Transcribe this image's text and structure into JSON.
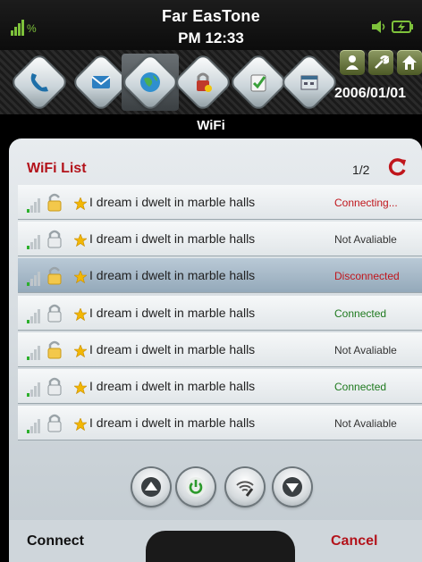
{
  "statusbar": {
    "carrier": "Far EasTone",
    "time": "PM 12:33",
    "icons": [
      "signal-icon",
      "speaker-icon",
      "battery-icon"
    ]
  },
  "toolbar": {
    "apps": [
      "phone-app-icon",
      "messaging-app-icon",
      "internet-app-icon",
      "security-app-icon",
      "tasks-app-icon",
      "calendar-app-icon"
    ],
    "active_app_index": 2,
    "shortcuts": [
      "contacts-icon",
      "settings-icon",
      "home-icon"
    ],
    "date": "2006/01/01"
  },
  "app": {
    "title": "WiFi"
  },
  "list": {
    "title": "WiFi List",
    "page": "1/2",
    "refresh_icon": "refresh-icon",
    "items": [
      {
        "name": "I dream i dwelt in marble halls",
        "status": "Connecting...",
        "status_color": "#c0161c",
        "lock": "unlocked",
        "selected": false
      },
      {
        "name": "I dream i dwelt in marble halls",
        "status": "Not Avaliable",
        "status_color": "#333333",
        "lock": "locked",
        "selected": false
      },
      {
        "name": "I dream i dwelt in marble halls",
        "status": "Disconnected",
        "status_color": "#c0161c",
        "lock": "unlocked",
        "selected": true
      },
      {
        "name": "I dream i dwelt in marble halls",
        "status": "Connected",
        "status_color": "#1f7a1f",
        "lock": "locked",
        "selected": false
      },
      {
        "name": "I dream i dwelt in marble halls",
        "status": "Not Avaliable",
        "status_color": "#333333",
        "lock": "unlocked",
        "selected": false
      },
      {
        "name": "I dream i dwelt in marble halls",
        "status": "Connected",
        "status_color": "#1f7a1f",
        "lock": "locked",
        "selected": false
      },
      {
        "name": "I dream i dwelt in marble halls",
        "status": "Not Avaliable",
        "status_color": "#333333",
        "lock": "locked",
        "selected": false
      }
    ]
  },
  "controls": [
    "scroll-up-icon",
    "power-icon",
    "wifi-settings-icon",
    "scroll-down-icon"
  ],
  "softkeys": {
    "left": "Connect",
    "right": "Cancel"
  },
  "colors": {
    "accent_red": "#b3131b",
    "connected_green": "#1f7a1f"
  }
}
